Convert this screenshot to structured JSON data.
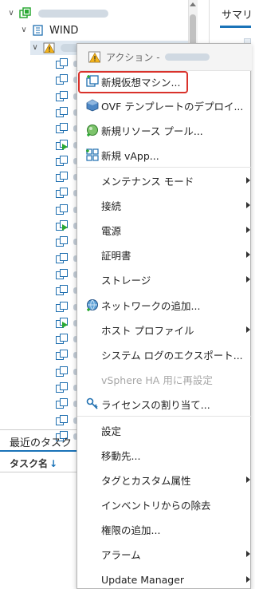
{
  "tree": {
    "root": {
      "expand": "∨",
      "icon": "datacenter-icon"
    },
    "cluster": {
      "expand": "∨",
      "label": "WIND",
      "icon": "cluster-icon"
    },
    "host": {
      "expand": "∨",
      "icon": "host-warning-icon"
    },
    "vm_count": 24,
    "running_vm_rows": [
      5,
      10,
      16
    ]
  },
  "right_pane": {
    "tab_label": "サマリ"
  },
  "tasks": {
    "title": "最近のタスク",
    "column_label": "タスク名",
    "sort_arrow": "↓"
  },
  "menu": {
    "title": "アクション -",
    "items": [
      {
        "label": "新規仮想マシン...",
        "icon": "new-vm-icon",
        "submenu": false,
        "disabled": false
      },
      {
        "label": "OVF テンプレートのデプロイ...",
        "icon": "ovf-deploy-icon",
        "submenu": false,
        "disabled": false
      },
      {
        "label": "新規リソース プール...",
        "icon": "resource-pool-icon",
        "submenu": false,
        "disabled": false
      },
      {
        "label": "新規 vApp...",
        "icon": "vapp-icon",
        "submenu": false,
        "disabled": false
      },
      {
        "label": "メンテナンス モード",
        "icon": "",
        "submenu": true,
        "disabled": false
      },
      {
        "label": "接続",
        "icon": "",
        "submenu": true,
        "disabled": false
      },
      {
        "label": "電源",
        "icon": "",
        "submenu": true,
        "disabled": false
      },
      {
        "label": "証明書",
        "icon": "",
        "submenu": true,
        "disabled": false
      },
      {
        "label": "ストレージ",
        "icon": "",
        "submenu": true,
        "disabled": false
      },
      {
        "label": "ネットワークの追加...",
        "icon": "add-network-icon",
        "submenu": false,
        "disabled": false
      },
      {
        "label": "ホスト プロファイル",
        "icon": "",
        "submenu": true,
        "disabled": false
      },
      {
        "label": "システム ログのエクスポート...",
        "icon": "",
        "submenu": false,
        "disabled": false
      },
      {
        "label": "vSphere HA 用に再設定",
        "icon": "",
        "submenu": false,
        "disabled": true
      },
      {
        "label": "ライセンスの割り当て...",
        "icon": "license-key-icon",
        "submenu": false,
        "disabled": false
      },
      {
        "label": "設定",
        "icon": "",
        "submenu": false,
        "disabled": false
      },
      {
        "label": "移動先...",
        "icon": "",
        "submenu": false,
        "disabled": false
      },
      {
        "label": "タグとカスタム属性",
        "icon": "",
        "submenu": true,
        "disabled": false
      },
      {
        "label": "インベントリからの除去",
        "icon": "",
        "submenu": false,
        "disabled": false
      },
      {
        "label": "権限の追加...",
        "icon": "",
        "submenu": false,
        "disabled": false
      },
      {
        "label": "アラーム",
        "icon": "",
        "submenu": true,
        "disabled": false
      },
      {
        "label": "Update Manager",
        "icon": "",
        "submenu": true,
        "disabled": false
      }
    ]
  },
  "colors": {
    "accent": "#1a73b8",
    "highlight_border": "#d9322b",
    "vm_icon": "#1f6fb0",
    "power_on": "#2aa833"
  }
}
